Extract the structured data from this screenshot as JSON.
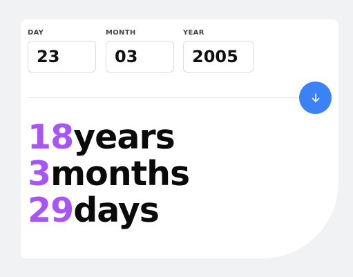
{
  "form": {
    "day": {
      "label": "DAY",
      "value": "23"
    },
    "month": {
      "label": "MONTH",
      "value": "03"
    },
    "year": {
      "label": "YEAR",
      "value": "2005"
    }
  },
  "submit": {
    "icon": "arrow-down-icon"
  },
  "result": {
    "years": {
      "value": "18",
      "unit": "years"
    },
    "months": {
      "value": "3",
      "unit": "months"
    },
    "days": {
      "value": "29",
      "unit": "days"
    }
  },
  "colors": {
    "accent": "#a855f7",
    "button": "#3b82f6",
    "background": "#f1f2f4",
    "card": "#ffffff"
  }
}
